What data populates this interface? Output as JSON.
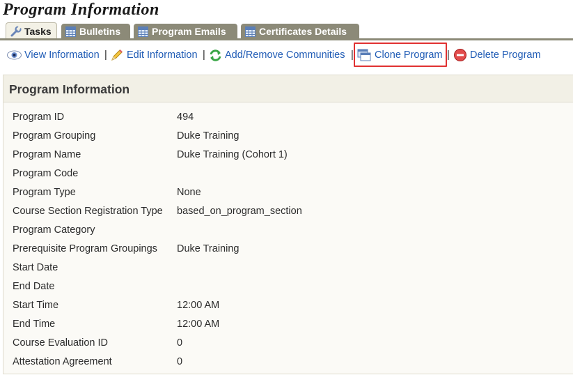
{
  "page_title": "Program Information",
  "tabs": [
    {
      "label": "Tasks",
      "icon": "wrench-icon",
      "active": true
    },
    {
      "label": "Bulletins",
      "icon": "table-icon",
      "active": false
    },
    {
      "label": "Program Emails",
      "icon": "table-icon",
      "active": false
    },
    {
      "label": "Certificates Details",
      "icon": "table-icon",
      "active": false
    }
  ],
  "toolbar": {
    "view_information": "View Information",
    "edit_information": "Edit Information",
    "add_remove_communities": "Add/Remove Communities",
    "clone_program": "Clone Program",
    "delete_program": "Delete Program",
    "separator": "|"
  },
  "panel": {
    "title": "Program Information",
    "rows": [
      {
        "label": "Program ID",
        "value": "494"
      },
      {
        "label": "Program Grouping",
        "value": "Duke Training"
      },
      {
        "label": "Program Name",
        "value": "Duke Training (Cohort 1)"
      },
      {
        "label": "Program Code",
        "value": ""
      },
      {
        "label": "Program Type",
        "value": "None"
      },
      {
        "label": "Course Section Registration Type",
        "value": "based_on_program_section"
      },
      {
        "label": "Program Category",
        "value": ""
      },
      {
        "label": "Prerequisite Program Groupings",
        "value": "Duke Training"
      },
      {
        "label": "Start Date",
        "value": ""
      },
      {
        "label": "End Date",
        "value": ""
      },
      {
        "label": "Start Time",
        "value": "12:00 AM"
      },
      {
        "label": "End Time",
        "value": "12:00 AM"
      },
      {
        "label": "Course Evaluation ID",
        "value": "0"
      },
      {
        "label": "Attestation Agreement",
        "value": "0"
      }
    ]
  },
  "colors": {
    "link": "#1f5bb5",
    "tab_inactive": "#8c8a78",
    "highlight": "#e03232"
  }
}
